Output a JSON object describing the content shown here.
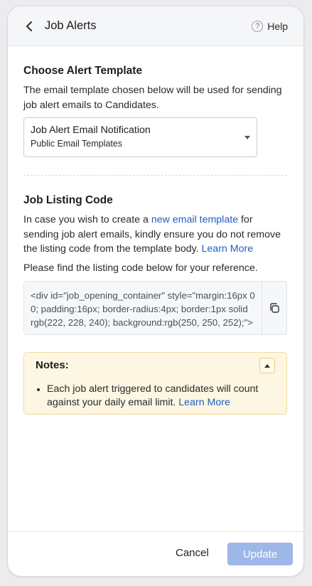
{
  "header": {
    "title": "Job Alerts",
    "help_label": "Help",
    "help_glyph": "?"
  },
  "template_section": {
    "heading": "Choose Alert Template",
    "description": "The email template chosen below will be used for sending job alert emails to Candidates.",
    "select": {
      "selected": "Job Alert Email Notification",
      "group": "Public Email Templates"
    }
  },
  "listing_section": {
    "heading": "Job Listing Code",
    "desc_prefix": "In case you wish to create a ",
    "desc_link": "new email template",
    "desc_suffix": " for sending job alert emails, kindly ensure you do not remove the listing code from the template body. ",
    "learn_more": "Learn More",
    "reference_text": "Please find the listing code below for your reference.",
    "code": "<div id=\"job_opening_container\" style=\"margin:16px 0 0; padding:16px; border-radius:4px; border:1px solid rgb(222, 228, 240); background:rgb(250, 250, 252);\">"
  },
  "notes": {
    "title": "Notes:",
    "item_text": "Each job alert triggered to candidates will count against your daily email limit. ",
    "item_link": "Learn More"
  },
  "footer": {
    "cancel_label": "Cancel",
    "update_label": "Update"
  },
  "colors": {
    "link": "#1f5fbf",
    "update_disabled": "#9cb7e8",
    "notes_bg": "#fdf6e3"
  }
}
